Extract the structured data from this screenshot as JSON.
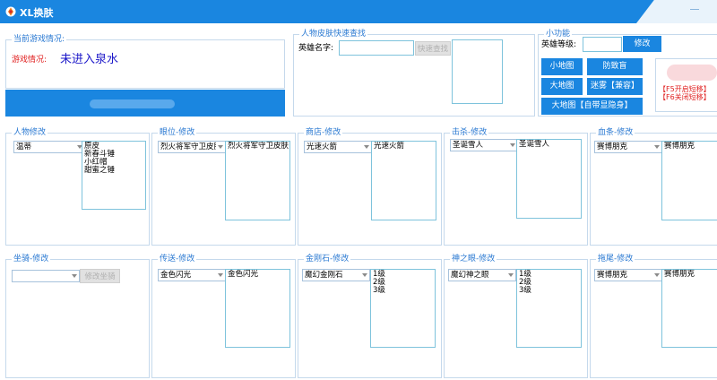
{
  "window": {
    "title": "XL换肤",
    "min_symbol": "—",
    "accent": "#1a86e0"
  },
  "game_status": {
    "group_label": "当前游戏情况:",
    "status_label": "游戏情况:",
    "status_value": "未进入泉水",
    "status_value_color": "#1c18c9"
  },
  "quick_find": {
    "group_label": "人物皮肤快速查找",
    "name_label": "英雄名字:",
    "name_value": "",
    "find_button": "快速查找"
  },
  "functions": {
    "group_label": "小功能",
    "level_label": "英雄等级:",
    "level_value": "",
    "modify_button": "修改",
    "buttons": [
      "小地图",
      "防致盲",
      "大地图",
      "迷雾【兼容】",
      "大地图【自带显隐身】"
    ],
    "notes": [
      "【F5开启短移】",
      "【F6关闭短移】"
    ]
  },
  "modules": [
    {
      "title": "人物修改",
      "select": "温蒂",
      "list": [
        "原皮",
        "新春斗锤",
        "小红帽",
        "甜蜜之锤"
      ]
    },
    {
      "title": "眼位-修改",
      "select": "烈火将军守卫皮肤",
      "list": [
        "烈火将军守卫皮肤"
      ]
    },
    {
      "title": "商店-修改",
      "select": "光速火箭",
      "list": [
        "光速火箭"
      ]
    },
    {
      "title": "击杀-修改",
      "select": "圣诞雪人",
      "list": [
        "圣诞雪人"
      ]
    },
    {
      "title": "血条-修改",
      "select": "赛博朋克",
      "list": [
        "赛博朋克"
      ]
    },
    {
      "title": "坐骑-修改",
      "select": "",
      "button": "修改坐骑"
    },
    {
      "title": "传送-修改",
      "select": "金色闪光",
      "list": [
        "金色闪光"
      ]
    },
    {
      "title": "金刚石-修改",
      "select": "魔幻金刚石",
      "list": [
        "1级",
        "2级",
        "3级"
      ]
    },
    {
      "title": "神之眼-修改",
      "select": "魔幻神之眼",
      "list": [
        "1级",
        "2级",
        "3级"
      ]
    },
    {
      "title": "拖尾-修改",
      "select": "赛博朋克",
      "list": [
        "赛博朋克"
      ]
    }
  ]
}
